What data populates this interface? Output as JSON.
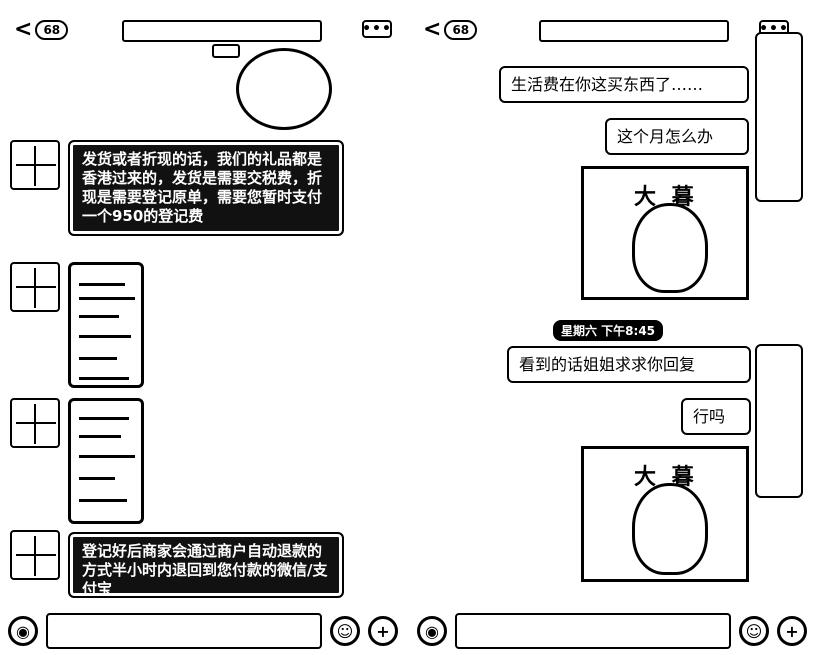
{
  "left": {
    "header": {
      "back_count": "68",
      "more_label": "•••"
    },
    "messages": {
      "m1": "发货或者折现的话，我们的礼品都是香港过来的，发货是需要交税费，折现是需要登记原单，需要您暂时支付一个950的登记费",
      "m2": "登记好后商家会通过商户自动退款的方式半小时内退回到您付款的微信/支付宝"
    }
  },
  "right": {
    "header": {
      "back_count": "68",
      "more_label": "•••"
    },
    "messages": {
      "m1": "生活费在你这买东西了……",
      "m2": "这个月怎么办",
      "m3": "看到的话姐姐求求你回复",
      "m4": "行吗"
    },
    "timestamp": "星期六 下午8:45",
    "photo_caption": "大 暮"
  },
  "icons": {
    "voice": "voice-icon",
    "emoji": "emoji-icon",
    "plus": "plus-icon",
    "back": "chevron-left-icon"
  }
}
